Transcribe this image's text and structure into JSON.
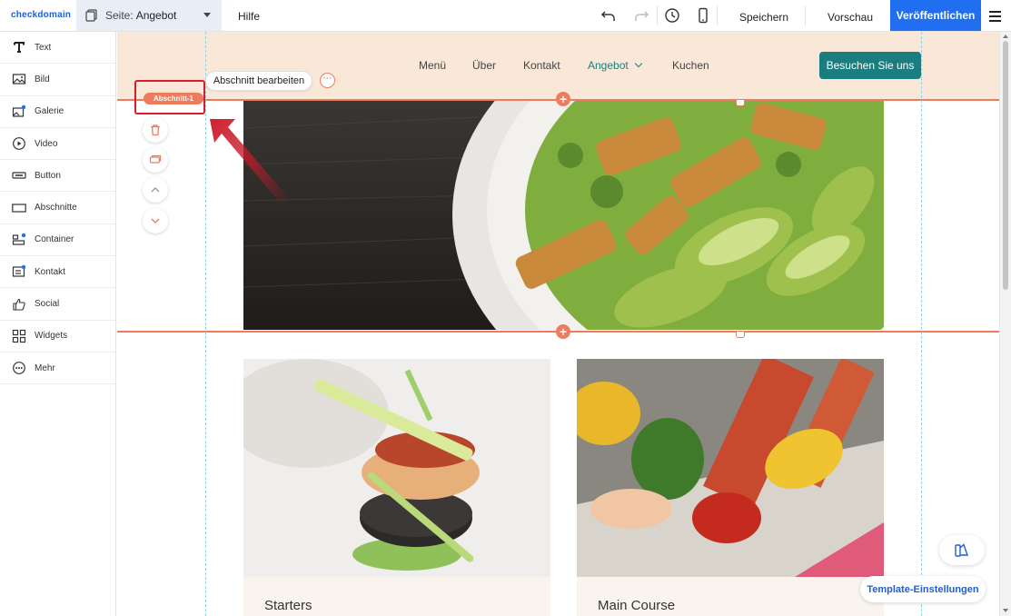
{
  "topbar": {
    "logo": "checkdomain",
    "page_prefix": "Seite:",
    "page_name": "Angebot",
    "help": "Hilfe",
    "save": "Speichern",
    "preview": "Vorschau",
    "publish": "Veröffentlichen"
  },
  "sidebar": {
    "items": [
      {
        "label": "Text",
        "icon": "text-icon"
      },
      {
        "label": "Bild",
        "icon": "image-icon"
      },
      {
        "label": "Galerie",
        "icon": "gallery-icon"
      },
      {
        "label": "Video",
        "icon": "video-icon"
      },
      {
        "label": "Button",
        "icon": "button-icon"
      },
      {
        "label": "Abschnitte",
        "icon": "section-icon"
      },
      {
        "label": "Container",
        "icon": "container-icon"
      },
      {
        "label": "Kontakt",
        "icon": "contact-icon"
      },
      {
        "label": "Social",
        "icon": "social-icon"
      },
      {
        "label": "Widgets",
        "icon": "widgets-icon"
      },
      {
        "label": "Mehr",
        "icon": "more-icon"
      }
    ]
  },
  "site": {
    "nav": [
      "Menü",
      "Über",
      "Kontakt",
      "Angebot",
      "Kuchen"
    ],
    "active_nav": "Angebot",
    "cta": "Besuchen Sie uns",
    "section_label": "Abschnitt-1",
    "edit_section": "Abschnitt bearbeiten",
    "cards": [
      {
        "title": "Starters"
      },
      {
        "title": "Main Course"
      }
    ]
  },
  "floating": {
    "template_settings": "Template-Einstellungen"
  },
  "colors": {
    "accent": "#ef7b5d",
    "brand_blue": "#1f6ff0",
    "teal": "#1a7d80",
    "header_bg": "#f9e7d8",
    "highlight": "#d81e2c"
  }
}
